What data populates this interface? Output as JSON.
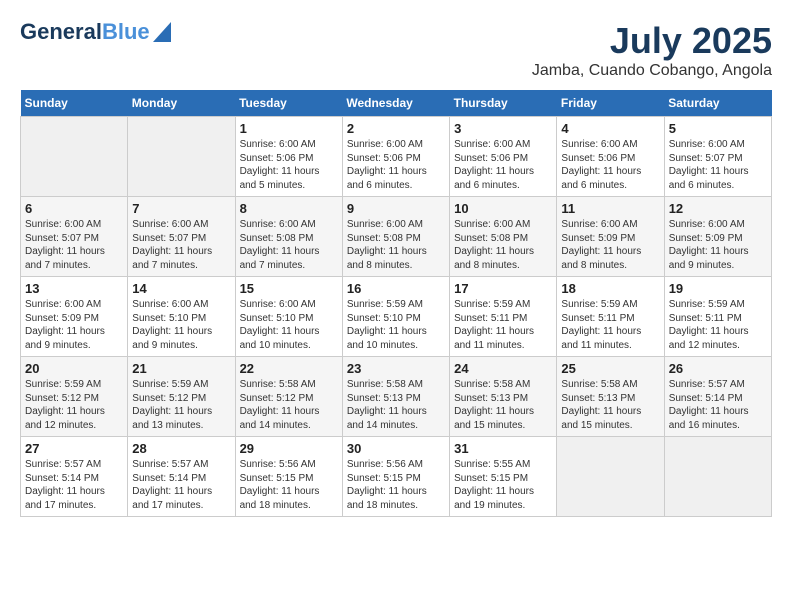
{
  "header": {
    "logo_line1": "General",
    "logo_line2": "Blue",
    "month_year": "July 2025",
    "location": "Jamba, Cuando Cobango, Angola"
  },
  "weekdays": [
    "Sunday",
    "Monday",
    "Tuesday",
    "Wednesday",
    "Thursday",
    "Friday",
    "Saturday"
  ],
  "weeks": [
    [
      {
        "day": "",
        "detail": ""
      },
      {
        "day": "",
        "detail": ""
      },
      {
        "day": "1",
        "detail": "Sunrise: 6:00 AM\nSunset: 5:06 PM\nDaylight: 11 hours\nand 5 minutes."
      },
      {
        "day": "2",
        "detail": "Sunrise: 6:00 AM\nSunset: 5:06 PM\nDaylight: 11 hours\nand 6 minutes."
      },
      {
        "day": "3",
        "detail": "Sunrise: 6:00 AM\nSunset: 5:06 PM\nDaylight: 11 hours\nand 6 minutes."
      },
      {
        "day": "4",
        "detail": "Sunrise: 6:00 AM\nSunset: 5:06 PM\nDaylight: 11 hours\nand 6 minutes."
      },
      {
        "day": "5",
        "detail": "Sunrise: 6:00 AM\nSunset: 5:07 PM\nDaylight: 11 hours\nand 6 minutes."
      }
    ],
    [
      {
        "day": "6",
        "detail": "Sunrise: 6:00 AM\nSunset: 5:07 PM\nDaylight: 11 hours\nand 7 minutes."
      },
      {
        "day": "7",
        "detail": "Sunrise: 6:00 AM\nSunset: 5:07 PM\nDaylight: 11 hours\nand 7 minutes."
      },
      {
        "day": "8",
        "detail": "Sunrise: 6:00 AM\nSunset: 5:08 PM\nDaylight: 11 hours\nand 7 minutes."
      },
      {
        "day": "9",
        "detail": "Sunrise: 6:00 AM\nSunset: 5:08 PM\nDaylight: 11 hours\nand 8 minutes."
      },
      {
        "day": "10",
        "detail": "Sunrise: 6:00 AM\nSunset: 5:08 PM\nDaylight: 11 hours\nand 8 minutes."
      },
      {
        "day": "11",
        "detail": "Sunrise: 6:00 AM\nSunset: 5:09 PM\nDaylight: 11 hours\nand 8 minutes."
      },
      {
        "day": "12",
        "detail": "Sunrise: 6:00 AM\nSunset: 5:09 PM\nDaylight: 11 hours\nand 9 minutes."
      }
    ],
    [
      {
        "day": "13",
        "detail": "Sunrise: 6:00 AM\nSunset: 5:09 PM\nDaylight: 11 hours\nand 9 minutes."
      },
      {
        "day": "14",
        "detail": "Sunrise: 6:00 AM\nSunset: 5:10 PM\nDaylight: 11 hours\nand 9 minutes."
      },
      {
        "day": "15",
        "detail": "Sunrise: 6:00 AM\nSunset: 5:10 PM\nDaylight: 11 hours\nand 10 minutes."
      },
      {
        "day": "16",
        "detail": "Sunrise: 5:59 AM\nSunset: 5:10 PM\nDaylight: 11 hours\nand 10 minutes."
      },
      {
        "day": "17",
        "detail": "Sunrise: 5:59 AM\nSunset: 5:11 PM\nDaylight: 11 hours\nand 11 minutes."
      },
      {
        "day": "18",
        "detail": "Sunrise: 5:59 AM\nSunset: 5:11 PM\nDaylight: 11 hours\nand 11 minutes."
      },
      {
        "day": "19",
        "detail": "Sunrise: 5:59 AM\nSunset: 5:11 PM\nDaylight: 11 hours\nand 12 minutes."
      }
    ],
    [
      {
        "day": "20",
        "detail": "Sunrise: 5:59 AM\nSunset: 5:12 PM\nDaylight: 11 hours\nand 12 minutes."
      },
      {
        "day": "21",
        "detail": "Sunrise: 5:59 AM\nSunset: 5:12 PM\nDaylight: 11 hours\nand 13 minutes."
      },
      {
        "day": "22",
        "detail": "Sunrise: 5:58 AM\nSunset: 5:12 PM\nDaylight: 11 hours\nand 14 minutes."
      },
      {
        "day": "23",
        "detail": "Sunrise: 5:58 AM\nSunset: 5:13 PM\nDaylight: 11 hours\nand 14 minutes."
      },
      {
        "day": "24",
        "detail": "Sunrise: 5:58 AM\nSunset: 5:13 PM\nDaylight: 11 hours\nand 15 minutes."
      },
      {
        "day": "25",
        "detail": "Sunrise: 5:58 AM\nSunset: 5:13 PM\nDaylight: 11 hours\nand 15 minutes."
      },
      {
        "day": "26",
        "detail": "Sunrise: 5:57 AM\nSunset: 5:14 PM\nDaylight: 11 hours\nand 16 minutes."
      }
    ],
    [
      {
        "day": "27",
        "detail": "Sunrise: 5:57 AM\nSunset: 5:14 PM\nDaylight: 11 hours\nand 17 minutes."
      },
      {
        "day": "28",
        "detail": "Sunrise: 5:57 AM\nSunset: 5:14 PM\nDaylight: 11 hours\nand 17 minutes."
      },
      {
        "day": "29",
        "detail": "Sunrise: 5:56 AM\nSunset: 5:15 PM\nDaylight: 11 hours\nand 18 minutes."
      },
      {
        "day": "30",
        "detail": "Sunrise: 5:56 AM\nSunset: 5:15 PM\nDaylight: 11 hours\nand 18 minutes."
      },
      {
        "day": "31",
        "detail": "Sunrise: 5:55 AM\nSunset: 5:15 PM\nDaylight: 11 hours\nand 19 minutes."
      },
      {
        "day": "",
        "detail": ""
      },
      {
        "day": "",
        "detail": ""
      }
    ]
  ]
}
